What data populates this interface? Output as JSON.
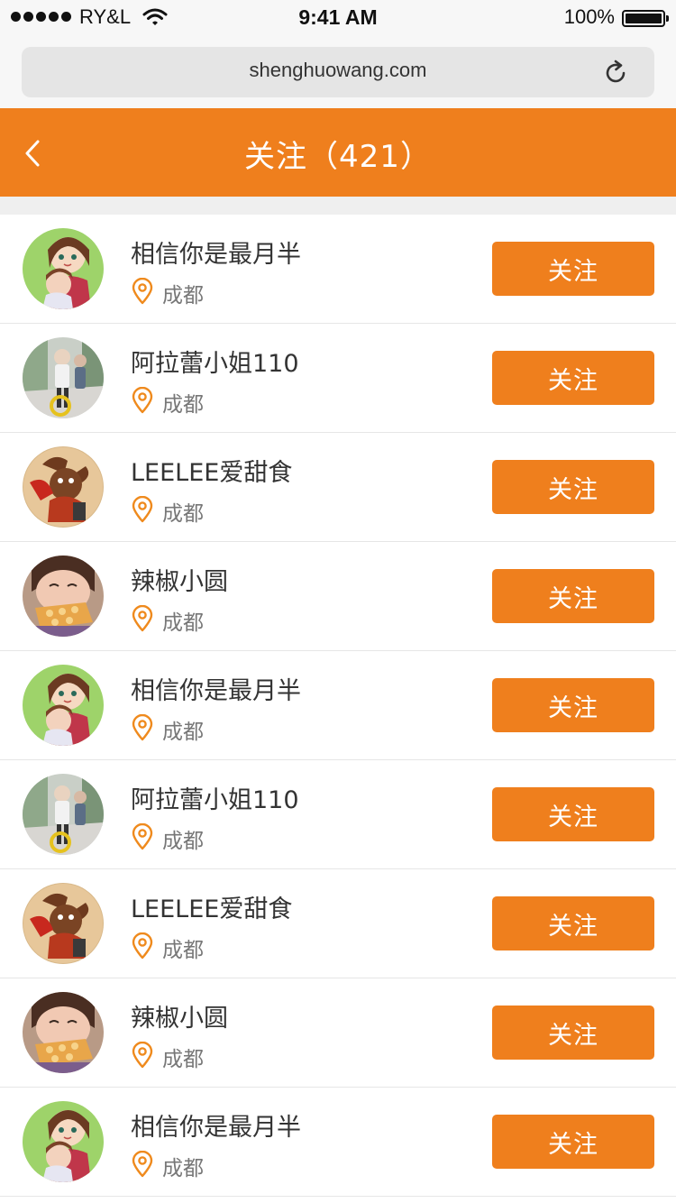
{
  "status_bar": {
    "carrier": "RY&L",
    "time": "9:41 AM",
    "battery_percent": "100%",
    "battery_level": 1.0
  },
  "browser": {
    "url": "shenghuowang.com"
  },
  "header": {
    "title": "关注（421）",
    "accent_color": "#ef7f1d"
  },
  "follow_list": [
    {
      "name": "相信你是最月半",
      "location": "成都",
      "button": "关注",
      "avatar": "avatar-girl-cartoon"
    },
    {
      "name": "阿拉蕾小姐110",
      "location": "成都",
      "button": "关注",
      "avatar": "avatar-street-photo"
    },
    {
      "name": "LEELEE爱甜食",
      "location": "成都",
      "button": "关注",
      "avatar": "avatar-toy"
    },
    {
      "name": "辣椒小圆",
      "location": "成都",
      "button": "关注",
      "avatar": "avatar-child-bread"
    },
    {
      "name": "相信你是最月半",
      "location": "成都",
      "button": "关注",
      "avatar": "avatar-girl-cartoon"
    },
    {
      "name": "阿拉蕾小姐110",
      "location": "成都",
      "button": "关注",
      "avatar": "avatar-street-photo"
    },
    {
      "name": "LEELEE爱甜食",
      "location": "成都",
      "button": "关注",
      "avatar": "avatar-toy"
    },
    {
      "name": "辣椒小圆",
      "location": "成都",
      "button": "关注",
      "avatar": "avatar-child-bread"
    },
    {
      "name": "相信你是最月半",
      "location": "成都",
      "button": "关注",
      "avatar": "avatar-girl-cartoon"
    }
  ]
}
